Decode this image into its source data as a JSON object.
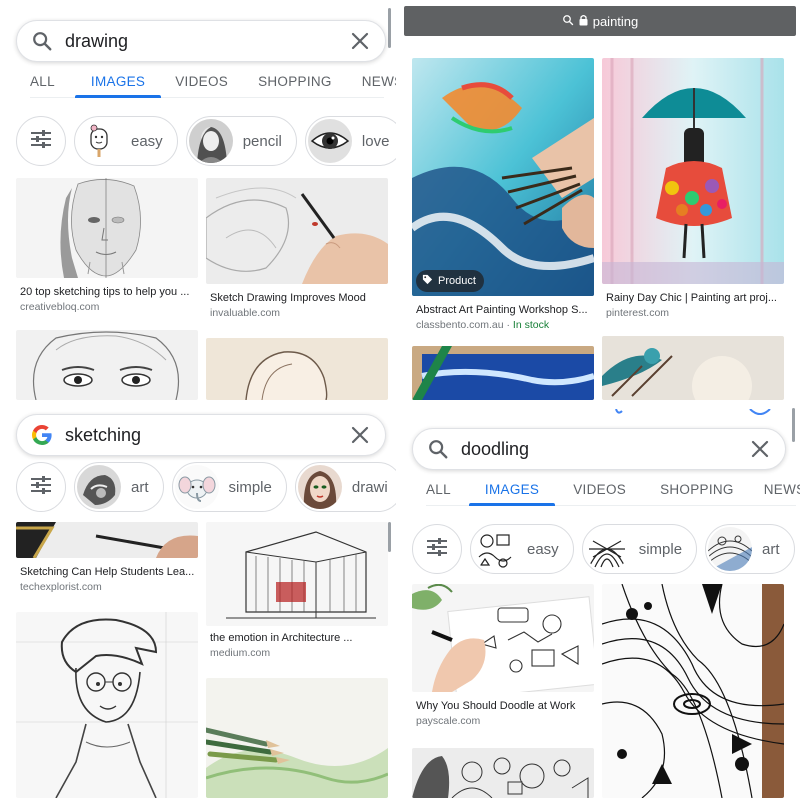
{
  "drawing": {
    "query": "drawing",
    "tabs": [
      "ALL",
      "IMAGES",
      "VIDEOS",
      "SHOPPING",
      "NEWS"
    ],
    "active_tab": "IMAGES",
    "chips": [
      "easy",
      "pencil",
      "love"
    ],
    "results": [
      {
        "title": "20 top sketching tips to help you ...",
        "source": "creativebloq.com"
      },
      {
        "title": "Sketch Drawing Improves Mood",
        "source": "invaluable.com"
      }
    ]
  },
  "painting": {
    "url": "painting",
    "results": [
      {
        "title": "Abstract Art Painting Workshop S...",
        "source": "classbento.com.au",
        "stock": "In stock",
        "badge": "Product"
      },
      {
        "title": "Rainy Day Chic | Painting art proj...",
        "source": "pinterest.com"
      }
    ]
  },
  "sketching": {
    "query": "sketching",
    "chips": [
      "art",
      "simple",
      "drawi"
    ],
    "results": [
      {
        "title": "Sketching Can Help Students Lea...",
        "source": "techexplorist.com"
      },
      {
        "title": "the emotion in Architecture ...",
        "source": "medium.com"
      }
    ]
  },
  "doodling": {
    "query": "doodling",
    "tabs": [
      "ALL",
      "IMAGES",
      "VIDEOS",
      "SHOPPING",
      "NEWS"
    ],
    "active_tab": "IMAGES",
    "chips": [
      "easy",
      "simple",
      "art"
    ],
    "results": [
      {
        "title": "Why You Should Doodle at Work",
        "source": "payscale.com"
      }
    ]
  },
  "icons": {
    "search": "search-icon",
    "clear": "close-icon",
    "tune": "tune-icon",
    "google": "google-logo",
    "lock": "lock-icon",
    "tag": "tag-icon"
  },
  "colors": {
    "accent": "#1a73e8",
    "in_stock": "#188038",
    "text_secondary": "#5f6368"
  }
}
